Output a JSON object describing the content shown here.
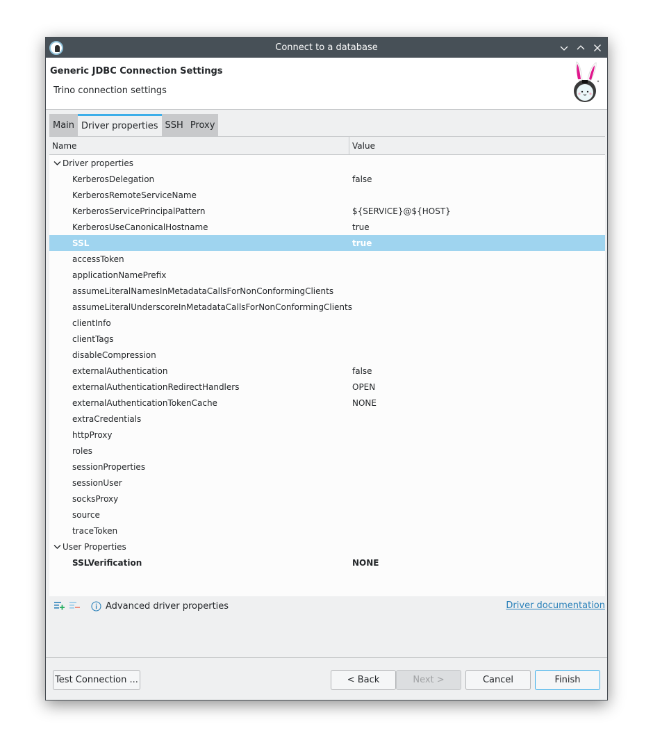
{
  "window": {
    "title": "Connect to a database",
    "controls": [
      "minimize",
      "maximize",
      "close"
    ]
  },
  "header": {
    "title": "Generic JDBC Connection Settings",
    "subtitle": "Trino connection settings"
  },
  "tabs": [
    {
      "label": "Main",
      "active": false
    },
    {
      "label": "Driver properties",
      "active": true
    },
    {
      "label": "SSH",
      "active": false
    },
    {
      "label": "Proxy",
      "active": false
    }
  ],
  "table": {
    "columns": [
      "Name",
      "Value"
    ],
    "groups": [
      {
        "label": "Driver properties",
        "expanded": true,
        "rows": [
          {
            "name": "KerberosDelegation",
            "value": "false"
          },
          {
            "name": "KerberosRemoteServiceName",
            "value": ""
          },
          {
            "name": "KerberosServicePrincipalPattern",
            "value": "${SERVICE}@${HOST}"
          },
          {
            "name": "KerberosUseCanonicalHostname",
            "value": "true"
          },
          {
            "name": "SSL",
            "value": "true",
            "selected": true
          },
          {
            "name": "accessToken",
            "value": ""
          },
          {
            "name": "applicationNamePrefix",
            "value": ""
          },
          {
            "name": "assumeLiteralNamesInMetadataCallsForNonConformingClients",
            "value": ""
          },
          {
            "name": "assumeLiteralUnderscoreInMetadataCallsForNonConformingClients",
            "value": ""
          },
          {
            "name": "clientInfo",
            "value": ""
          },
          {
            "name": "clientTags",
            "value": ""
          },
          {
            "name": "disableCompression",
            "value": ""
          },
          {
            "name": "externalAuthentication",
            "value": "false"
          },
          {
            "name": "externalAuthenticationRedirectHandlers",
            "value": "OPEN"
          },
          {
            "name": "externalAuthenticationTokenCache",
            "value": "NONE"
          },
          {
            "name": "extraCredentials",
            "value": ""
          },
          {
            "name": "httpProxy",
            "value": ""
          },
          {
            "name": "roles",
            "value": ""
          },
          {
            "name": "sessionProperties",
            "value": ""
          },
          {
            "name": "sessionUser",
            "value": ""
          },
          {
            "name": "socksProxy",
            "value": ""
          },
          {
            "name": "source",
            "value": ""
          },
          {
            "name": "traceToken",
            "value": ""
          }
        ]
      },
      {
        "label": "User Properties",
        "expanded": true,
        "rows": [
          {
            "name": "SSLVerification",
            "value": "NONE",
            "bold": true
          }
        ]
      }
    ]
  },
  "footer": {
    "add_property_icon": "add-property-icon",
    "remove_property_icon": "remove-property-icon",
    "advanced_label": "Advanced driver properties",
    "doc_link": "Driver documentation"
  },
  "buttons": {
    "test_connection": "Test Connection ...",
    "back": "< Back",
    "next": "Next >",
    "cancel": "Cancel",
    "finish": "Finish"
  },
  "colors": {
    "titlebar": "#475057",
    "selection": "#9fd4ef",
    "accent": "#3daee9",
    "link": "#2980b9"
  }
}
